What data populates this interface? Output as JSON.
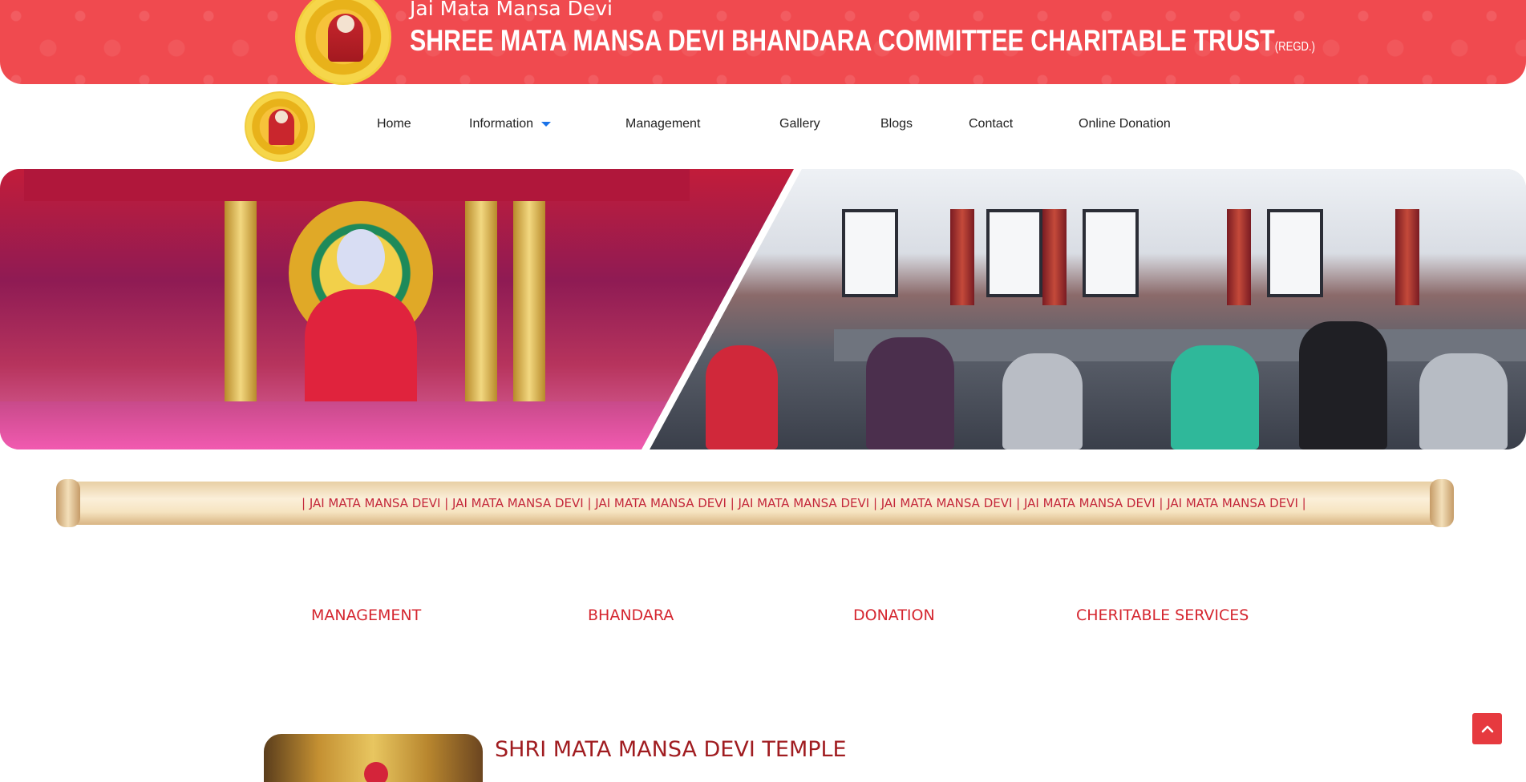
{
  "banner": {
    "subtitle": "Jai Mata Mansa Devi",
    "title": "SHREE MATA MANSA DEVI BHANDARA COMMITTEE CHARITABLE TRUST",
    "regd": "(REGD.)"
  },
  "nav": {
    "items": [
      {
        "label": "Home"
      },
      {
        "label": "Information"
      },
      {
        "label": "Management"
      },
      {
        "label": "Gallery"
      },
      {
        "label": "Blogs"
      },
      {
        "label": "Contact"
      },
      {
        "label": "Online Donation"
      }
    ]
  },
  "marquee": {
    "text": "|   JAI MATA MANSA DEVI   |   JAI MATA MANSA DEVI   |   JAI MATA MANSA DEVI   |   JAI MATA MANSA DEVI   | JAI MATA MANSA DEVI   |   JAI MATA MANSA DEVI   |   JAI MATA MANSA DEVI   |"
  },
  "features": [
    {
      "label": "MANAGEMENT"
    },
    {
      "label": "BHANDARA"
    },
    {
      "label": "DONATION"
    },
    {
      "label": "CHERITABLE SERVICES"
    }
  ],
  "temple": {
    "title": "SHRI MATA MANSA DEVI TEMPLE"
  },
  "colors": {
    "banner": "#f04a4f",
    "accent_red": "#d5262f",
    "nav_caret": "#1a73e8"
  },
  "icons": {
    "back_to_top": "chevron-up-icon",
    "dropdown": "caret-down-icon"
  }
}
